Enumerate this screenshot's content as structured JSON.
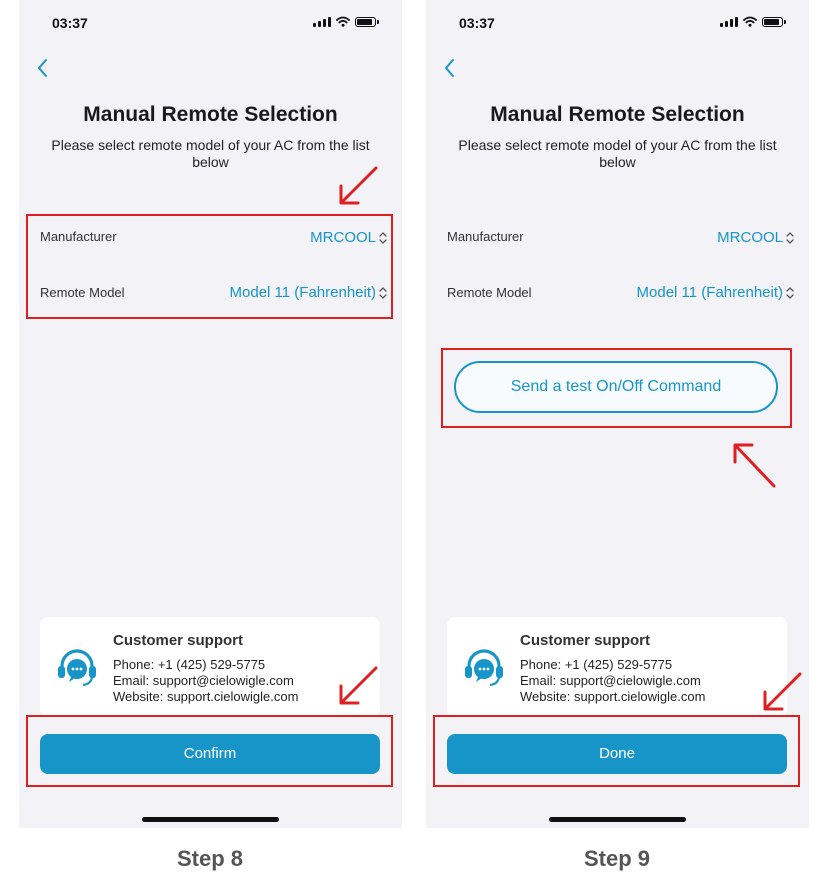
{
  "screens": [
    {
      "status": {
        "time": "03:37"
      },
      "title": "Manual Remote Selection",
      "subtitle": "Please select remote model of your AC from the list below",
      "manufacturer": {
        "label": "Manufacturer",
        "value": "MRCOOL"
      },
      "remote_model": {
        "label": "Remote Model",
        "value": "Model 11 (Fahrenheit)"
      },
      "support": {
        "title": "Customer support",
        "phone": "Phone: +1 (425) 529-5775",
        "email": "Email: support@cielowigle.com",
        "website": "Website: support.cielowigle.com"
      },
      "primary_button": "Confirm"
    },
    {
      "status": {
        "time": "03:37"
      },
      "title": "Manual Remote Selection",
      "subtitle": "Please select remote model of your AC from the list below",
      "manufacturer": {
        "label": "Manufacturer",
        "value": "MRCOOL"
      },
      "remote_model": {
        "label": "Remote Model",
        "value": "Model 11 (Fahrenheit)"
      },
      "test_button": "Send a test On/Off Command",
      "support": {
        "title": "Customer support",
        "phone": "Phone: +1 (425) 529-5775",
        "email": "Email: support@cielowigle.com",
        "website": "Website: support.cielowigle.com"
      },
      "primary_button": "Done"
    }
  ],
  "steps": [
    "Step 8",
    "Step 9"
  ],
  "colors": {
    "accent": "#1795c9",
    "highlight": "#e02020",
    "screen_bg": "#f2f2f7"
  },
  "icons": [
    "back-chevron-icon",
    "up-down-chevron-icon",
    "support-headset-icon",
    "signal-icon",
    "wifi-icon",
    "battery-icon",
    "arrow-icon"
  ]
}
